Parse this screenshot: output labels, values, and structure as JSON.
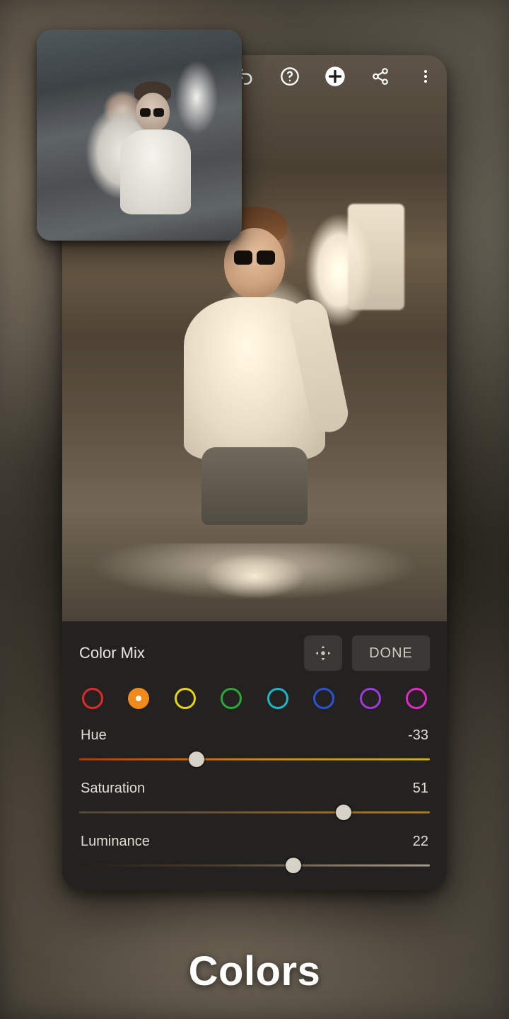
{
  "caption": "Colors",
  "toolbar_icons": [
    "undo",
    "help",
    "add",
    "share",
    "more"
  ],
  "panel": {
    "title": "Color Mix",
    "done_label": "DONE",
    "move_tool_icon": "pan-move"
  },
  "swatches": [
    {
      "name": "red",
      "color": "#e02a2a",
      "selected": false
    },
    {
      "name": "orange",
      "color": "#f08a1a",
      "selected": true
    },
    {
      "name": "yellow",
      "color": "#e8d414",
      "selected": false
    },
    {
      "name": "green",
      "color": "#2aa83a",
      "selected": false
    },
    {
      "name": "aqua",
      "color": "#1ab8c8",
      "selected": false
    },
    {
      "name": "blue",
      "color": "#2a52d8",
      "selected": false
    },
    {
      "name": "purple",
      "color": "#a038e0",
      "selected": false
    },
    {
      "name": "magenta",
      "color": "#e028c8",
      "selected": false
    }
  ],
  "sliders": {
    "hue": {
      "label": "Hue",
      "value": -33,
      "min": -100,
      "max": 100
    },
    "saturation": {
      "label": "Saturation",
      "value": 51,
      "min": -100,
      "max": 100
    },
    "luminance": {
      "label": "Luminance",
      "value": 22,
      "min": -100,
      "max": 100
    }
  }
}
